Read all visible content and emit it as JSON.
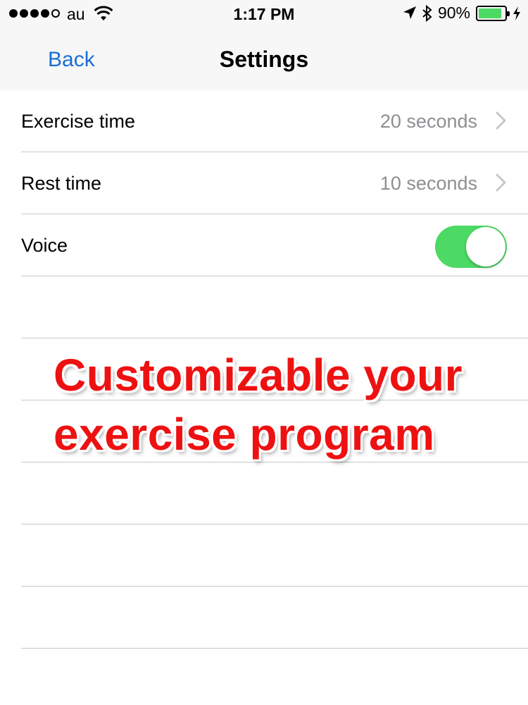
{
  "status_bar": {
    "carrier": "au",
    "time": "1:17 PM",
    "battery_percent": "90%",
    "battery_level": 0.9,
    "signal_bars": 4,
    "signal_total": 5
  },
  "nav": {
    "back_label": "Back",
    "title": "Settings"
  },
  "settings": [
    {
      "label": "Exercise time",
      "value": "20 seconds"
    },
    {
      "label": "Rest time",
      "value": "10 seconds"
    },
    {
      "label": "Voice",
      "toggle_on": true
    }
  ],
  "promo": {
    "line1": "Customizable your",
    "line2": "exercise program"
  },
  "colors": {
    "accent": "#1a6ed8",
    "toggle_on": "#4cd964",
    "promo_text": "#ee1111"
  }
}
